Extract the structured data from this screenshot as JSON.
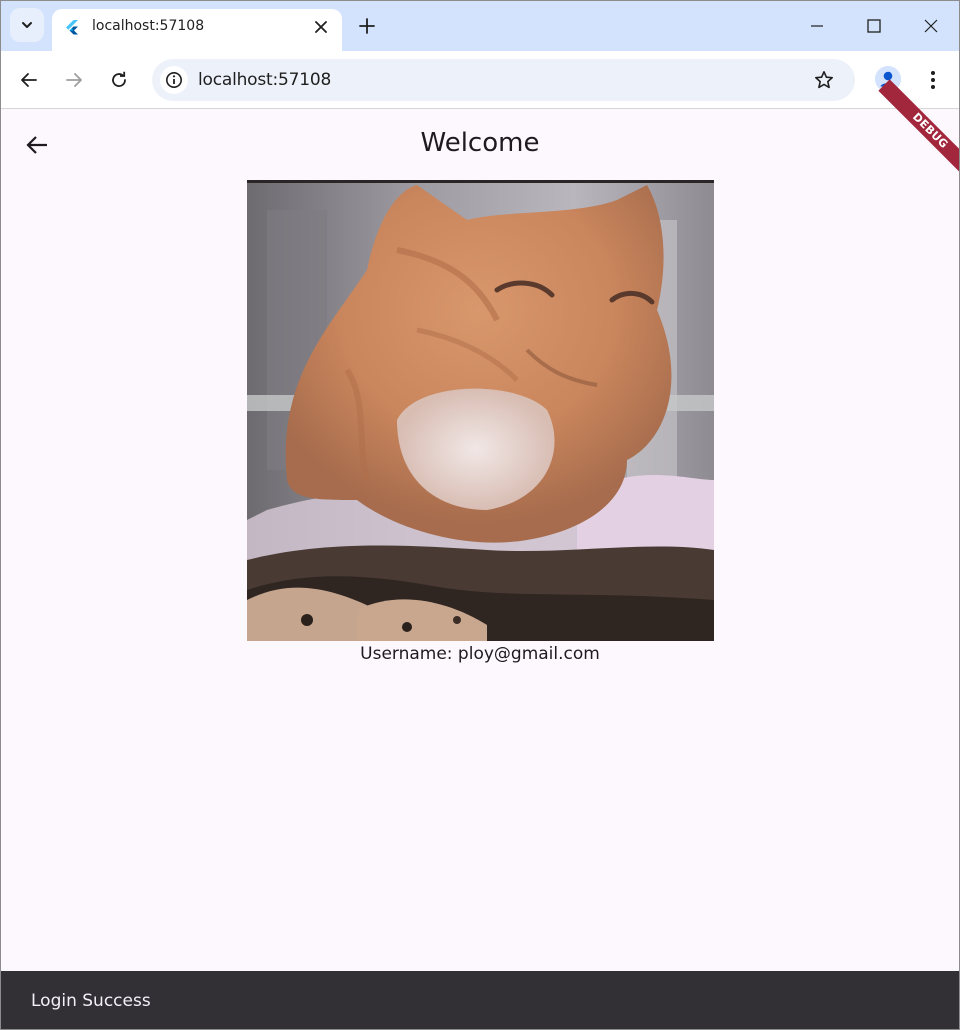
{
  "browser": {
    "tab": {
      "title": "localhost:57108"
    },
    "address_bar": {
      "url": "localhost:57108"
    }
  },
  "app": {
    "title": "Welcome",
    "debug_banner": "DEBUG",
    "username_text": "Username: ploy@gmail.com",
    "image": {
      "alt": "orange tabby cat"
    }
  },
  "snackbar": {
    "message": "Login Success"
  },
  "colors": {
    "tabstrip": "#d3e3fd",
    "app_background": "#fdf7fe",
    "snackbar": "#322f35",
    "debug_banner": "#a2263c"
  },
  "icons": {
    "tab_search": "chevron-down-icon",
    "tab_favicon": "flutter-icon",
    "tab_close": "close-icon",
    "new_tab": "plus-icon",
    "minimize": "minimize-icon",
    "maximize": "maximize-icon",
    "close_window": "close-icon",
    "nav_back": "arrow-left-icon",
    "nav_forward": "arrow-right-icon",
    "reload": "reload-icon",
    "site_info": "info-icon",
    "bookmark": "star-icon",
    "profile": "person-icon",
    "menu": "more-vert-icon",
    "app_back": "arrow-left-icon"
  }
}
